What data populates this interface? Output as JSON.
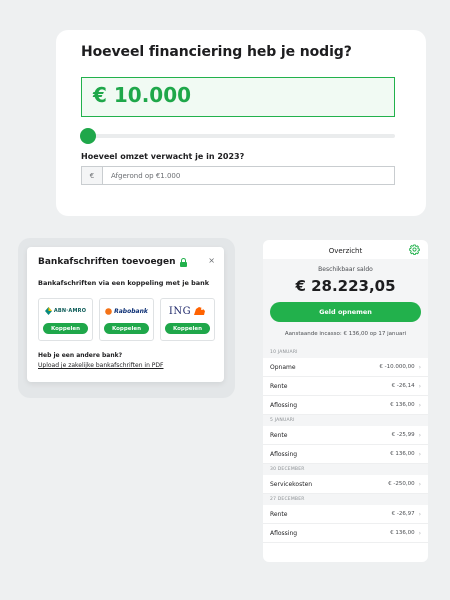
{
  "financing": {
    "title": "Hoeveel financiering heb je nodig?",
    "amount": "€ 10.000",
    "slider_fraction": 0.0,
    "revenue_label": "Hoeveel omzet verwacht je in 2023?",
    "currency_symbol": "€",
    "revenue_placeholder": "Afgerond op €1.000"
  },
  "bank_modal": {
    "title": "Bankafschriften toevoegen",
    "close": "×",
    "subtitle": "Bankafschriften via een koppeling met je bank",
    "banks": [
      {
        "name": "ABN·AMRO",
        "button": "Koppelen"
      },
      {
        "name": "Rabobank",
        "button": "Koppelen"
      },
      {
        "name": "ING",
        "button": "Koppelen"
      }
    ],
    "other_bank_question": "Heb je een andere bank?",
    "upload_link": "Upload je zakelijke bankafschriften in PDF"
  },
  "overview": {
    "title": "Overzicht",
    "balance_label": "Beschikbaar saldo",
    "balance": "€ 28.223,05",
    "withdraw_button": "Geld opnemen",
    "incasso_note": "Aanstaande incasso: € 136,00 op 17 januari",
    "groups": [
      {
        "date": "10 JANUARI",
        "items": [
          {
            "label": "Opname",
            "amount": "€ -10.000,00"
          },
          {
            "label": "Rente",
            "amount": "€ -26,14"
          },
          {
            "label": "Aflossing",
            "amount": "€ 136,00"
          }
        ]
      },
      {
        "date": "5 JANUARI",
        "items": [
          {
            "label": "Rente",
            "amount": "€ -25,99"
          },
          {
            "label": "Aflossing",
            "amount": "€ 136,00"
          }
        ]
      },
      {
        "date": "30 DECEMBER",
        "items": [
          {
            "label": "Servicekosten",
            "amount": "€ -250,00"
          }
        ]
      },
      {
        "date": "27 DECEMBER",
        "items": [
          {
            "label": "Rente",
            "amount": "€ -26,97"
          },
          {
            "label": "Aflossing",
            "amount": "€ 136,00"
          }
        ]
      }
    ]
  },
  "colors": {
    "brand_green": "#1fa74a",
    "accent_green": "#22b14c",
    "page_bg": "#eef0f1"
  }
}
